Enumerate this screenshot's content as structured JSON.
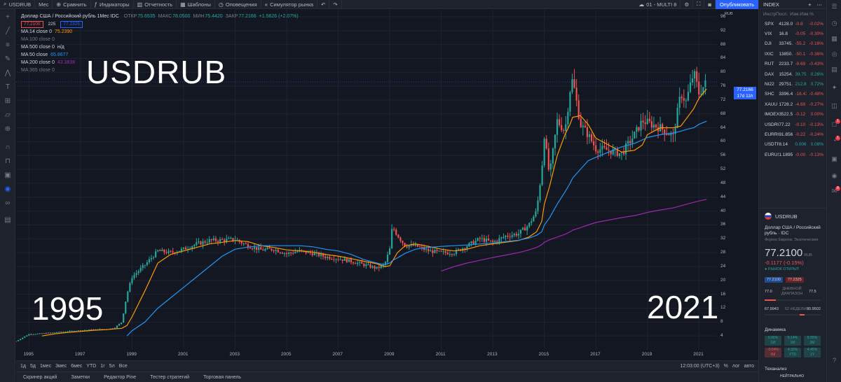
{
  "topbar": {
    "symbol": "USDRUB",
    "interval": "Мес",
    "compare": "Сравнить",
    "indicators": "Индикаторы",
    "financials": "Отчетность",
    "templates": "Шаблоны",
    "alerts": "Оповещения",
    "replay": "Симулятор рынка",
    "layout": "01 - MULTI 8",
    "publish": "Опубликовать"
  },
  "legend": {
    "title": "Доллар США / Российский рубль  1Мес  IDC",
    "open_label": "ОТКР",
    "open": "75.6535",
    "high_label": "МАКС",
    "high": "78.0500",
    "low_label": "МИН",
    "low": "75.4420",
    "close_label": "ЗАКР",
    "close": "77.2166",
    "change": "+1.5626 (+2.07%)",
    "bid": "77.2100",
    "spread": "225",
    "ask": "77.2325",
    "ma": [
      {
        "label": "MA 14 close 0",
        "value": "75.2390",
        "color": "#ff9800"
      },
      {
        "label": "MA 100 close 0",
        "value": "",
        "color": "#787b86"
      },
      {
        "label": "MA 500 close 0",
        "value": "н/д",
        "color": "#d1d4dc"
      },
      {
        "label": "MA 50 close",
        "value": "65.8677",
        "color": "#2196f3"
      },
      {
        "label": "MA 200 close 0",
        "value": "43.3838",
        "color": "#9c27b0"
      },
      {
        "label": "MA 365 close 0",
        "value": "",
        "color": "#787b86"
      }
    ]
  },
  "overlay": {
    "title": "USDRUB",
    "start_year": "1995",
    "end_year": "2021"
  },
  "price_axis": {
    "currency": "RUB",
    "labels": [
      "96",
      "92",
      "88",
      "84",
      "80",
      "76",
      "72",
      "68",
      "64",
      "60",
      "56",
      "52",
      "48",
      "44",
      "40",
      "36",
      "32",
      "28",
      "24",
      "20",
      "16",
      "12",
      "8",
      "4"
    ],
    "last_price": "77.2166",
    "countdown": "17d 11h"
  },
  "time_axis": {
    "labels": [
      "1995",
      "1997",
      "1999",
      "2001",
      "2003",
      "2005",
      "2007",
      "2009",
      "2011",
      "2013",
      "2015",
      "2017",
      "2019",
      "2021"
    ]
  },
  "bottombar": {
    "ranges": [
      "1д",
      "5д",
      "1мес",
      "3мес",
      "6мес",
      "YTD",
      "1г",
      "5л",
      "Все"
    ],
    "clock": "12:03:00 (UTC+3)",
    "percent": "%",
    "log": "лог",
    "auto": "авто"
  },
  "panel_tabs": [
    "Скринер акций",
    "Заметки",
    "Редактор Pine",
    "Тестер стратегий",
    "Торговая панель"
  ],
  "watchlist": {
    "title": "INDEX",
    "headers": {
      "symbol": "Инстр",
      "last": "Посл.",
      "change": "Изм.",
      "change_pct": "Изм.%"
    },
    "rows": [
      {
        "symbol": "SPX",
        "last": "4128.0",
        "chg": "-0.8",
        "pct": "-0.02%",
        "dir": "dn"
      },
      {
        "symbol": "VIX",
        "last": "16.8",
        "chg": "-0.05",
        "pct": "-0.30%",
        "dir": "dn"
      },
      {
        "symbol": "DJI",
        "last": "33745.",
        "chg": "-55.2",
        "pct": "-0.16%",
        "dir": "dn"
      },
      {
        "symbol": "IXIC",
        "last": "13850.",
        "chg": "-50.1",
        "pct": "-0.36%",
        "dir": "dn"
      },
      {
        "symbol": "RUT",
        "last": "2233.7",
        "chg": "-9.69",
        "pct": "-0.43%",
        "dir": "dn"
      },
      {
        "symbol": "DAX",
        "last": "15254.",
        "chg": "39.75",
        "pct": "0.26%",
        "dir": "up"
      },
      {
        "symbol": "NI22",
        "last": "29751.",
        "chg": "212.81",
        "pct": "0.72%",
        "dir": "up"
      },
      {
        "symbol": "SHC",
        "last": "3396.4",
        "chg": "-16.47",
        "pct": "-0.48%",
        "dir": "dn"
      },
      {
        "symbol": "XAUU",
        "last": "1728.2",
        "chg": "-4.69",
        "pct": "-0.27%",
        "dir": "dn"
      },
      {
        "symbol": "IMOEX",
        "last": "3522.5",
        "chg": "-0.12",
        "pct": "0.00%",
        "dir": "dn"
      },
      {
        "symbol": "USDRU",
        "last": "77.22",
        "chg": "-0.10",
        "pct": "-0.13%",
        "dir": "dn"
      },
      {
        "symbol": "EURRU",
        "last": "91.856",
        "chg": "-0.22",
        "pct": "-0.24%",
        "dir": "dn"
      },
      {
        "symbol": "USDTR",
        "last": "8.14",
        "chg": "0.0062",
        "pct": "0.08%",
        "dir": "up"
      },
      {
        "symbol": "EURUS",
        "last": "1.1895",
        "chg": "-0.00",
        "pct": "-0.13%",
        "dir": "dn"
      }
    ]
  },
  "details": {
    "symbol": "USDRUB",
    "name": "Доллар США / Российский рубль · IDC",
    "subtitle": "Форекс Европа: Экзотические",
    "price": "77.2100",
    "currency": "RUB",
    "change": "-0.1177 (-0.15%)",
    "market": "● РЫНОК ОТКРЫТ",
    "bid": "77.2100",
    "ask": "77.2325",
    "day_low": "77.0",
    "day_label": "ДНЕВНОЙ ДИАПАЗОН",
    "day_high": "77.5",
    "w52_low": "67.9943",
    "w52_label": "52 НЕДЕЛИ",
    "w52_high": "80.9502",
    "dynamics_title": "Динамика",
    "dynamics": [
      {
        "v": "0.06%",
        "p": "1W",
        "c": "g"
      },
      {
        "v": "6.14%",
        "p": "1M",
        "c": "g"
      },
      {
        "v": "5.55%",
        "p": "3M",
        "c": "g"
      },
      {
        "v": "-0.54%",
        "p": "6M",
        "c": "r"
      },
      {
        "v": "4.32%",
        "p": "YTD",
        "c": "g"
      },
      {
        "v": "4.45%",
        "p": "1Y",
        "c": "g"
      }
    ],
    "tech_title": "Теханализ",
    "tech_value": "НЕЙТРАЛЬНО"
  },
  "chart_data": {
    "type": "candlestick",
    "title": "Доллар США / Российский рубль  1Мес  IDC",
    "xlabel": "",
    "ylabel": "",
    "xlim": [
      1994.5,
      2021.7
    ],
    "ylim": [
      0,
      98
    ],
    "x": [
      1994.5,
      1995.0,
      1995.5,
      1996.0,
      1996.5,
      1997.0,
      1997.5,
      1998.0,
      1998.3,
      1998.6,
      1998.8,
      1999.0,
      1999.5,
      2000.0,
      2000.5,
      2001.0,
      2001.5,
      2002.0,
      2002.5,
      2003.0,
      2003.5,
      2004.0,
      2004.5,
      2005.0,
      2005.5,
      2006.0,
      2006.5,
      2007.0,
      2007.5,
      2008.0,
      2008.5,
      2008.8,
      2009.0,
      2009.1,
      2009.3,
      2009.6,
      2010.0,
      2010.5,
      2011.0,
      2011.5,
      2012.0,
      2012.5,
      2013.0,
      2013.5,
      2014.0,
      2014.4,
      2014.7,
      2014.9,
      2015.0,
      2015.2,
      2015.5,
      2015.8,
      2016.0,
      2016.1,
      2016.4,
      2016.7,
      2017.0,
      2017.5,
      2018.0,
      2018.5,
      2018.8,
      2019.0,
      2019.5,
      2020.0,
      2020.3,
      2020.5,
      2020.8,
      2021.0,
      2021.3
    ],
    "series": [
      {
        "name": "USDRUB",
        "values": [
          2.5,
          4.5,
          4.7,
          5.0,
          5.3,
          5.6,
          5.8,
          6.0,
          6.2,
          8.0,
          16.0,
          21.0,
          24.5,
          28.5,
          28.0,
          29.0,
          30.5,
          31.5,
          31.6,
          31.8,
          30.0,
          28.8,
          29.0,
          27.7,
          28.5,
          27.8,
          26.8,
          26.3,
          25.5,
          24.5,
          23.5,
          24.5,
          29.0,
          35.5,
          33.0,
          30.0,
          30.0,
          28.5,
          28.0,
          28.0,
          30.0,
          32.0,
          31.0,
          32.8,
          33.5,
          36.0,
          40.0,
          52.0,
          62.0,
          50.0,
          66.0,
          63.0,
          75.0,
          78.0,
          65.0,
          62.0,
          58.0,
          57.5,
          56.5,
          62.0,
          66.0,
          65.5,
          64.0,
          61.5,
          74.0,
          71.5,
          80.0,
          74.0,
          77.2
        ]
      },
      {
        "name": "MA 14 close 0",
        "values": [
          null,
          null,
          4.0,
          4.6,
          5.0,
          5.3,
          5.6,
          5.8,
          6.0,
          6.2,
          7.0,
          9.5,
          17.0,
          25.0,
          27.5,
          28.5,
          29.5,
          30.5,
          31.0,
          31.5,
          31.2,
          30.0,
          29.5,
          28.8,
          28.5,
          28.2,
          27.5,
          27.0,
          26.3,
          25.5,
          24.8,
          24.0,
          24.2,
          25.5,
          28.0,
          30.0,
          30.5,
          29.8,
          29.0,
          28.5,
          29.0,
          30.0,
          30.5,
          31.0,
          31.5,
          32.5,
          34.0,
          37.0,
          42.0,
          47.0,
          56.0,
          62.0,
          65.0,
          67.0,
          67.5,
          65.0,
          61.0,
          59.0,
          57.0,
          57.5,
          59.0,
          62.0,
          64.0,
          64.0,
          64.5,
          66.5,
          69.5,
          72.5,
          75.2
        ]
      },
      {
        "name": "MA 50 close",
        "values": [
          null,
          null,
          null,
          null,
          null,
          null,
          null,
          null,
          null,
          null,
          4.0,
          5.5,
          8.0,
          12.0,
          15.0,
          18.0,
          21.0,
          24.0,
          27.0,
          29.0,
          29.6,
          30.0,
          30.0,
          30.0,
          30.0,
          29.7,
          29.0,
          28.5,
          27.5,
          26.0,
          25.0,
          24.5,
          25.0,
          25.7,
          26.5,
          27.8,
          29.0,
          29.5,
          29.8,
          30.0,
          30.2,
          30.5,
          30.8,
          31.2,
          31.6,
          32.2,
          33.0,
          34.0,
          36.0,
          38.0,
          42.0,
          45.5,
          48.0,
          49.5,
          52.0,
          54.5,
          55.5,
          57.0,
          58.5,
          59.5,
          60.5,
          61.2,
          62.0,
          62.5,
          63.0,
          63.5,
          64.0,
          65.0,
          65.9
        ]
      },
      {
        "name": "MA 200 close 0",
        "values": [
          null,
          null,
          null,
          null,
          null,
          null,
          null,
          null,
          null,
          null,
          null,
          null,
          null,
          null,
          null,
          null,
          null,
          null,
          null,
          null,
          null,
          null,
          null,
          null,
          null,
          null,
          null,
          null,
          null,
          null,
          null,
          null,
          null,
          null,
          null,
          null,
          null,
          null,
          22.7,
          24.0,
          25.0,
          25.8,
          26.6,
          27.3,
          28.0,
          28.8,
          29.5,
          30.3,
          31.0,
          31.7,
          32.5,
          33.3,
          34.0,
          34.5,
          35.2,
          36.0,
          36.7,
          37.4,
          38.1,
          38.7,
          39.2,
          39.6,
          40.3,
          40.9,
          41.5,
          41.9,
          42.5,
          42.9,
          43.4
        ]
      }
    ],
    "grid": true,
    "legend": "top-left"
  }
}
